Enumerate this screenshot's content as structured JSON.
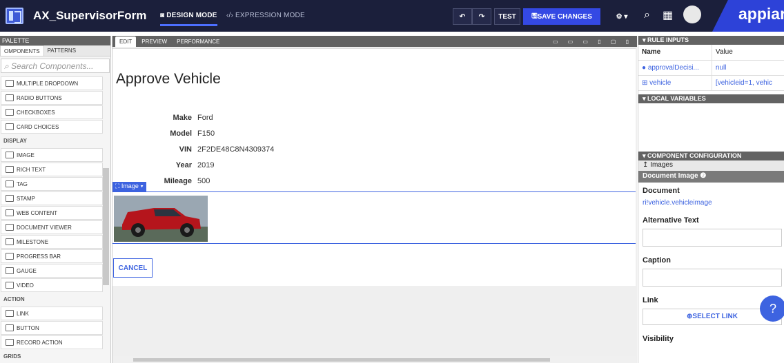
{
  "app": {
    "title": "AX_SupervisorForm",
    "design_mode": "DESIGN MODE",
    "expression_mode": "EXPRESSION MODE",
    "test_label": "TEST",
    "save_label": "SAVE CHANGES",
    "brand": "appiar"
  },
  "palette": {
    "title": "PALETTE",
    "tabs": [
      "OMPONENTS",
      "PATTERNS"
    ],
    "search_placeholder": "Search Components...",
    "items": [
      {
        "kind": "item",
        "label": "MULTIPLE DROPDOWN"
      },
      {
        "kind": "item",
        "label": "RADIO BUTTONS"
      },
      {
        "kind": "item",
        "label": "CHECKBOXES"
      },
      {
        "kind": "item",
        "label": "CARD CHOICES"
      },
      {
        "kind": "section",
        "label": "DISPLAY"
      },
      {
        "kind": "item",
        "label": "IMAGE"
      },
      {
        "kind": "item",
        "label": "RICH TEXT"
      },
      {
        "kind": "item",
        "label": "TAG"
      },
      {
        "kind": "item",
        "label": "STAMP"
      },
      {
        "kind": "item",
        "label": "WEB CONTENT"
      },
      {
        "kind": "item",
        "label": "DOCUMENT VIEWER"
      },
      {
        "kind": "item",
        "label": "MILESTONE"
      },
      {
        "kind": "item",
        "label": "PROGRESS BAR"
      },
      {
        "kind": "item",
        "label": "GAUGE"
      },
      {
        "kind": "item",
        "label": "VIDEO"
      },
      {
        "kind": "section",
        "label": "ACTION"
      },
      {
        "kind": "item",
        "label": "LINK"
      },
      {
        "kind": "item",
        "label": "BUTTON"
      },
      {
        "kind": "item",
        "label": "RECORD ACTION"
      },
      {
        "kind": "section",
        "label": "GRIDS"
      }
    ]
  },
  "editor": {
    "tabs": [
      "EDIT",
      "PREVIEW",
      "PERFORMANCE"
    ],
    "form_title": "Approve Vehicle",
    "fields": [
      {
        "label": "Make",
        "value": "Ford"
      },
      {
        "label": "Model",
        "value": "F150"
      },
      {
        "label": "VIN",
        "value": "2F2DE48C8N4309374"
      },
      {
        "label": "Year",
        "value": "2019"
      },
      {
        "label": "Mileage",
        "value": "500"
      }
    ],
    "image_tag": "Image",
    "cancel_label": "CANCEL"
  },
  "right": {
    "rule_inputs": "RULE INPUTS",
    "col_name": "Name",
    "col_value": "Value",
    "inputs": [
      {
        "name": "approvalDecisi...",
        "value": "null"
      },
      {
        "name": "vehicle",
        "value": "[vehicleid=1, vehic"
      }
    ],
    "local_variables": "LOCAL VARIABLES",
    "component_config": "COMPONENT CONFIGURATION",
    "breadcrumb": "Images",
    "doc_image": "Document Image",
    "document_label": "Document",
    "document_value": "ri!vehicle.vehicleimage",
    "alt_text": "Alternative Text",
    "caption": "Caption",
    "link": "Link",
    "select_link": "SELECT LINK",
    "visibility": "Visibility"
  },
  "colors": {
    "topbar": "#1b1f3b",
    "accent": "#3d63e0",
    "panel_header": "#636363"
  }
}
